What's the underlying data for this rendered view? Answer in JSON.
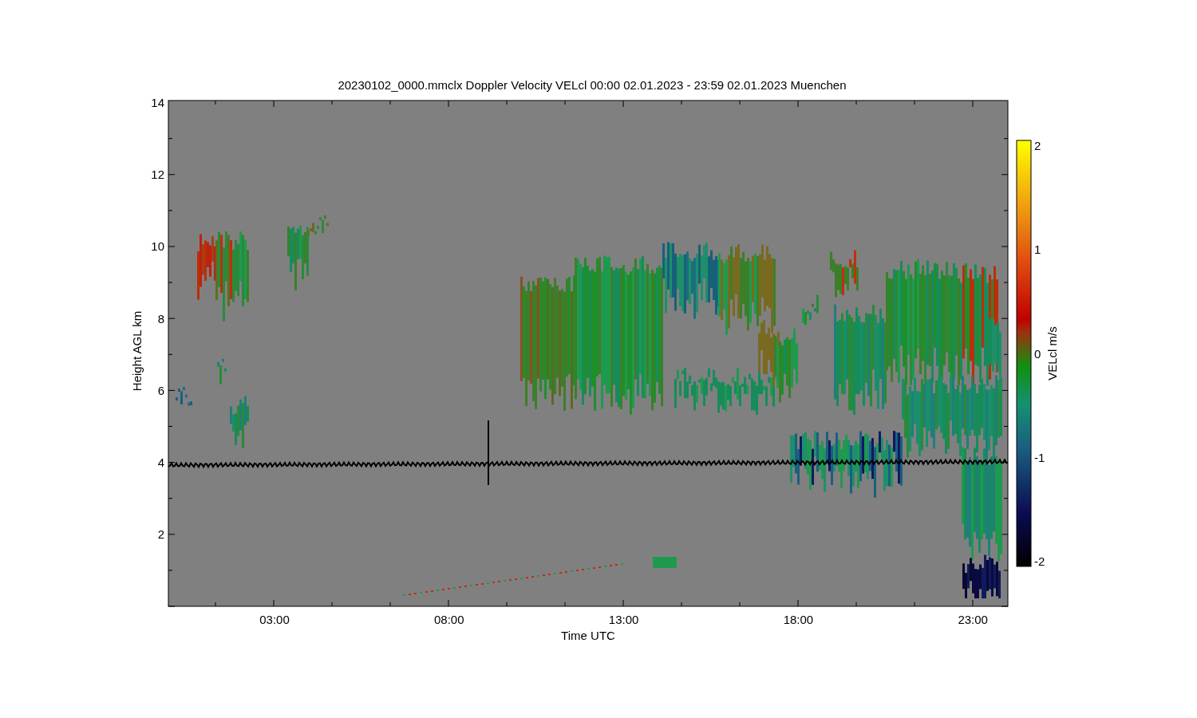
{
  "title": "20230102_0000.mmclx Doppler Velocity VELcl   00:00 02.01.2023 - 23:59 02.01.2023 Muenchen",
  "y_axis": {
    "label": "Height AGL km",
    "ticks": [
      "14",
      "12",
      "10",
      "8",
      "6",
      "4",
      "2"
    ]
  },
  "x_axis": {
    "label": "Time UTC",
    "ticks": [
      "03:00",
      "08:00",
      "13:00",
      "18:00",
      "23:00"
    ]
  },
  "colorbar": {
    "label": "VELcl m/s",
    "ticks": [
      "2",
      "1",
      "0",
      "-1",
      "-2"
    ]
  }
}
